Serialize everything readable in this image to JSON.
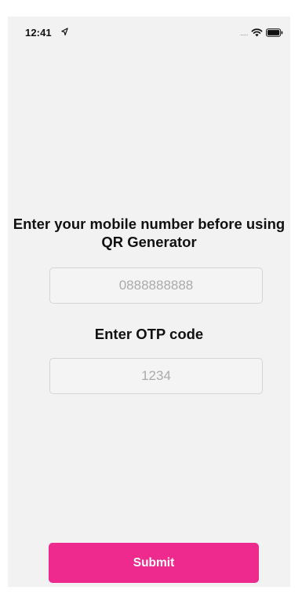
{
  "status_bar": {
    "time": "12:41",
    "icons": [
      "location-arrow-icon",
      "signal-dots-icon",
      "wifi-icon",
      "battery-icon"
    ],
    "signal_glyph": "....."
  },
  "form": {
    "prompt": "Enter your mobile number before using QR Generator",
    "mobile_placeholder": "0888888888",
    "otp_label": "Enter OTP code",
    "otp_placeholder": "1234",
    "submit_label": "Submit"
  },
  "colors": {
    "background": "#f2f2f2",
    "accent": "#ee2a8f",
    "field_border": "#d5d5d5",
    "placeholder": "#ababab"
  }
}
